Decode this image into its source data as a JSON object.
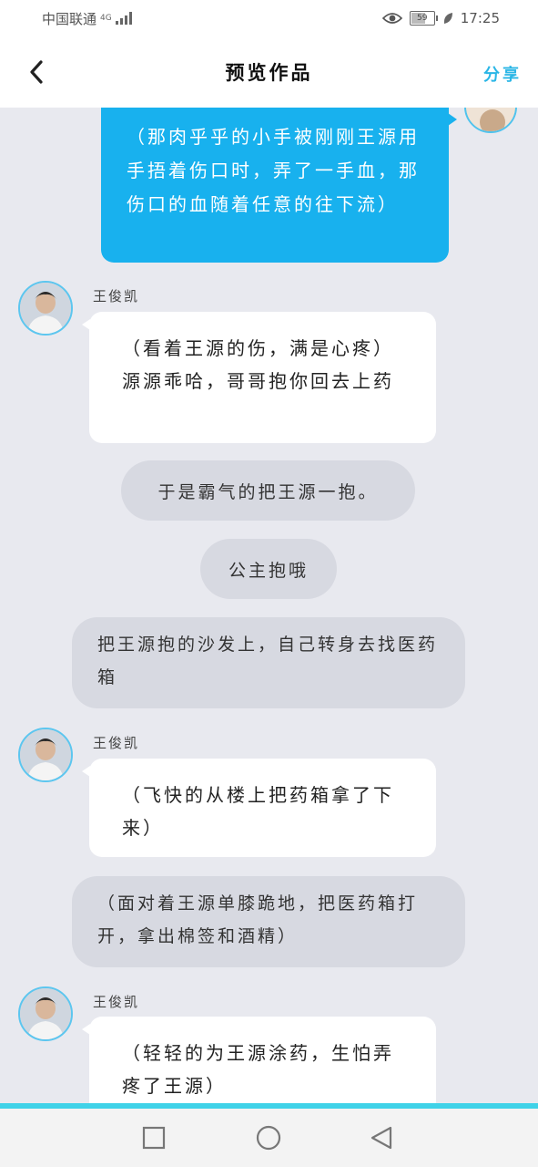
{
  "status_bar": {
    "carrier": "中国联通",
    "network": "4G",
    "battery": "59",
    "battery_level": 0.59,
    "time": "17:25"
  },
  "header": {
    "title": "预览作品",
    "share_label": "分享"
  },
  "chat": {
    "self_message": "（那肉乎乎的小手被刚刚王源用手捂着伤口时，弄了一手血，那伤口的血随着任意的往下流）",
    "messages": [
      {
        "speaker": "王俊凯",
        "text": "（看着王源的伤，满是心疼）源源乖哈，哥哥抱你回去上药"
      },
      {
        "narration": "于是霸气的把王源一抱。"
      },
      {
        "narration": "公主抱哦"
      },
      {
        "narration": "把王源抱的沙发上，自己转身去找医药箱"
      },
      {
        "speaker": "王俊凯",
        "text": "（飞快的从楼上把药箱拿了下来）"
      },
      {
        "narration": "（面对着王源单膝跪地，把医药箱打开，拿出棉签和酒精）"
      },
      {
        "speaker": "王俊凯",
        "text": "（轻轻的为王源涂药，生怕弄疼了王源）"
      }
    ]
  },
  "nav": {
    "icons": [
      "recent-apps-icon",
      "home-icon",
      "back-icon"
    ]
  },
  "colors": {
    "accent": "#18b1ee",
    "share": "#2ab6e6",
    "background": "#e8e9ef",
    "narration_bubble": "#d7d9e1",
    "bottom_line": "#3fd2e8"
  }
}
